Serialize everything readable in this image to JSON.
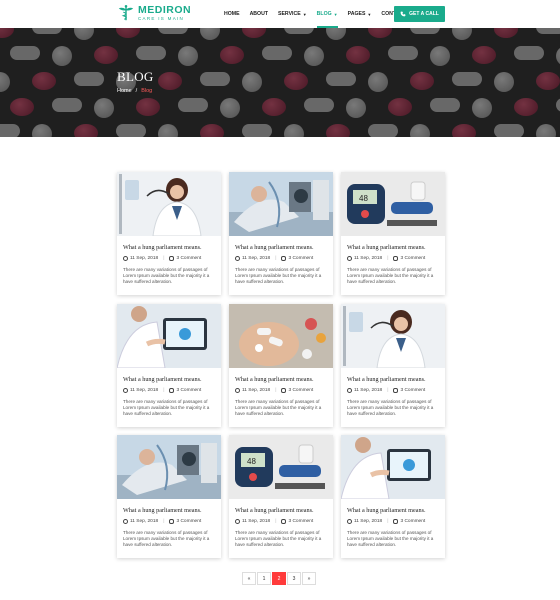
{
  "brand": {
    "name": "MEDIRON",
    "tagline": "CARE IS MAIN",
    "color": "#1aab8c"
  },
  "nav": {
    "items": [
      {
        "label": "HOME",
        "dropdown": false,
        "active": false
      },
      {
        "label": "ABOUT",
        "dropdown": false,
        "active": false
      },
      {
        "label": "SERVICE",
        "dropdown": true,
        "active": false
      },
      {
        "label": "BLOG",
        "dropdown": true,
        "active": true
      },
      {
        "label": "PAGES",
        "dropdown": true,
        "active": false
      },
      {
        "label": "CONTACT",
        "dropdown": false,
        "active": false
      }
    ],
    "cta": {
      "label": "GET A CALL",
      "icon": "phone-icon"
    }
  },
  "banner": {
    "title": "BLOG",
    "breadcrumb": {
      "home": "Home",
      "separator": "/",
      "current": "Blog"
    }
  },
  "posts": [
    {
      "image": "doctor-woman",
      "title": "What a hung parliament means.",
      "date": "11 Sep, 2018",
      "comments": "3 Comment",
      "excerpt": "There are many variations of passages of Lorem Ipsum available but the majority it a have suffered alteration."
    },
    {
      "image": "hospital-patient",
      "title": "What a hung parliament means.",
      "date": "11 Sep, 2018",
      "comments": "3 Comment",
      "excerpt": "There are many variations of passages of Lorem Ipsum available but the majority it a have suffered alteration."
    },
    {
      "image": "glucose-meter",
      "title": "What a hung parliament means.",
      "date": "11 Sep, 2018",
      "comments": "3 Comment",
      "excerpt": "There are many variations of passages of Lorem Ipsum available but the majority it a have suffered alteration."
    },
    {
      "image": "doctor-tablet",
      "title": "What a hung parliament means.",
      "date": "11 Sep, 2018",
      "comments": "3 Comment",
      "excerpt": "There are many variations of passages of Lorem Ipsum available but the majority it a have suffered alteration."
    },
    {
      "image": "pills-hand",
      "title": "What a hung parliament means.",
      "date": "11 Sep, 2018",
      "comments": "3 Comment",
      "excerpt": "There are many variations of passages of Lorem Ipsum available but the majority it a have suffered alteration."
    },
    {
      "image": "doctor-woman",
      "title": "What a hung parliament means.",
      "date": "11 Sep, 2018",
      "comments": "3 Comment",
      "excerpt": "There are many variations of passages of Lorem Ipsum available but the majority it a have suffered alteration."
    },
    {
      "image": "hospital-patient",
      "title": "What a hung parliament means.",
      "date": "11 Sep, 2018",
      "comments": "3 Comment",
      "excerpt": "There are many variations of passages of Lorem Ipsum available but the majority it a have suffered alteration."
    },
    {
      "image": "glucose-meter",
      "title": "What a hung parliament means.",
      "date": "11 Sep, 2018",
      "comments": "3 Comment",
      "excerpt": "There are many variations of passages of Lorem Ipsum available but the majority it a have suffered alteration."
    },
    {
      "image": "doctor-tablet",
      "title": "What a hung parliament means.",
      "date": "11 Sep, 2018",
      "comments": "3 Comment",
      "excerpt": "There are many variations of passages of Lorem Ipsum available but the majority it a have suffered alteration."
    }
  ],
  "pagination": {
    "prev": "«",
    "pages": [
      "1",
      "2",
      "3"
    ],
    "current": "2",
    "next": "»",
    "accent": "#ff3b3b"
  }
}
